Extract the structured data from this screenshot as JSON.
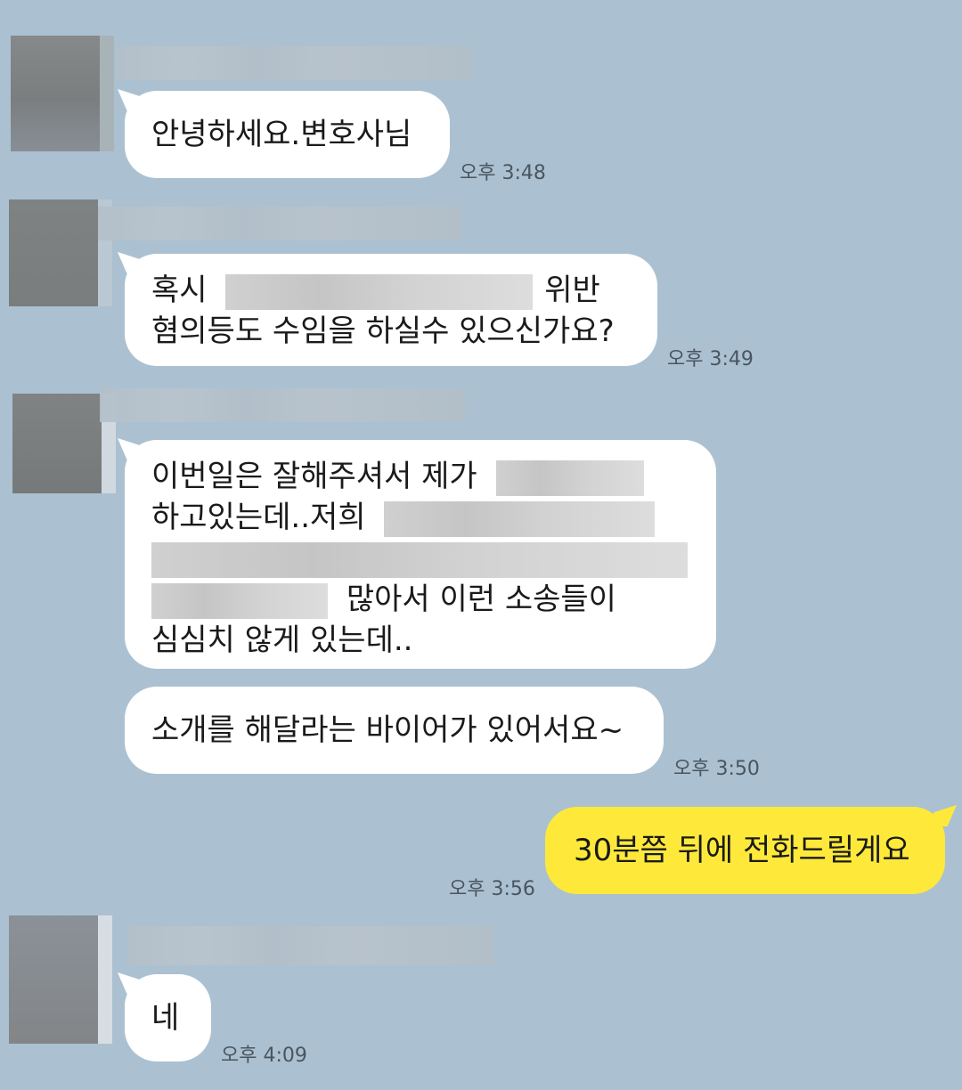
{
  "messages": [
    {
      "sender": "other",
      "lines": [
        "안녕하세요.변호사님"
      ],
      "time": "오후 3:48"
    },
    {
      "sender": "other",
      "line1_before": "혹시",
      "line1_after": "위반",
      "line2": "혐의등도 수임을 하실수 있으신가요?",
      "time": "오후 3:49"
    },
    {
      "sender": "other",
      "line1": "이번일은 잘해주셔서 제가",
      "line2": "하고있는데..저희",
      "line4_after": "많아서 이런 소송들이",
      "line5": "심심치 않게 있는데..",
      "time": ""
    },
    {
      "sender": "other",
      "lines": [
        "소개를 해달라는 바이어가 있어서요~"
      ],
      "time": "오후 3:50"
    },
    {
      "sender": "me",
      "lines": [
        "30분쯤 뒤에 전화드릴게요"
      ],
      "time": "오후 3:56"
    },
    {
      "sender": "other",
      "lines": [
        "네"
      ],
      "time": "오후 4:09"
    }
  ],
  "colors": {
    "background": "#abc1d1",
    "my_bubble": "#fee93a",
    "other_bubble": "#ffffff"
  }
}
